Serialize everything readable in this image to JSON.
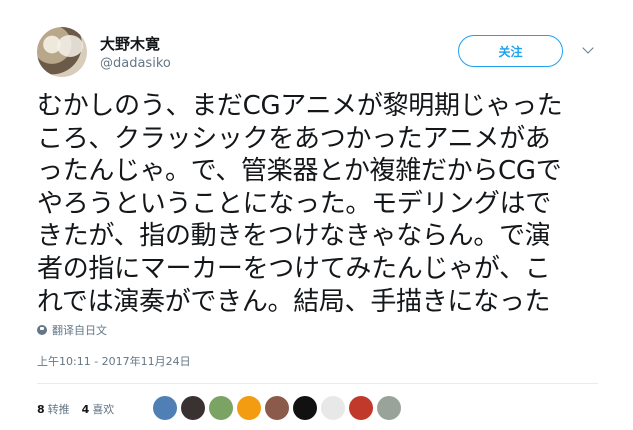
{
  "author": {
    "display_name": "大野木寛",
    "handle": "@dadasiko"
  },
  "follow_button": {
    "label": "关注"
  },
  "tweet": {
    "lines": [
      "むかしのう、まだCGアニメが黎明期じゃった",
      "ころ、クラッシックをあつかったアニメがあ",
      "ったんじゃ。で、管楽器とか複雑だからCGで",
      "やろうということになった。モデリングはで",
      "きたが、指の動きをつけなきゃならん。で演",
      "者の指にマーカーをつけてみたんじゃが、こ",
      "れでは演奏ができん。結局、手描きになった"
    ],
    "translate_label": "翻译自日文",
    "timestamp": "上午10:11 - 2017年11月24日"
  },
  "stats": {
    "retweets_count": "8",
    "retweets_label": "转推",
    "likes_count": "4",
    "likes_label": "喜欢"
  },
  "liker_avatars": [
    {
      "color": "#4f7fb4"
    },
    {
      "color": "#3a3230"
    },
    {
      "color": "#7aa364"
    },
    {
      "color": "#f39c12"
    },
    {
      "color": "#8c5a4a"
    },
    {
      "color": "#111111"
    },
    {
      "color": "#e8e8e8"
    },
    {
      "color": "#c0392b"
    },
    {
      "color": "#9aa39a"
    }
  ]
}
